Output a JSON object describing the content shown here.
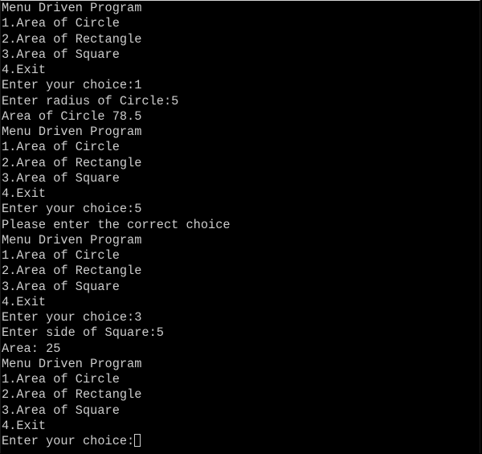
{
  "console": {
    "lines": [
      "Menu Driven Program",
      "1.Area of Circle",
      "2.Area of Rectangle",
      "3.Area of Square",
      "4.Exit",
      "Enter your choice:1",
      "Enter radius of Circle:5",
      "Area of Circle 78.5",
      "Menu Driven Program",
      "1.Area of Circle",
      "2.Area of Rectangle",
      "3.Area of Square",
      "4.Exit",
      "Enter your choice:5",
      "Please enter the correct choice",
      "Menu Driven Program",
      "1.Area of Circle",
      "2.Area of Rectangle",
      "3.Area of Square",
      "4.Exit",
      "Enter your choice:3",
      "Enter side of Square:5",
      "Area: 25",
      "Menu Driven Program",
      "1.Area of Circle",
      "2.Area of Rectangle",
      "3.Area of Square",
      "4.Exit"
    ],
    "prompt": "Enter your choice:",
    "input_value": ""
  }
}
